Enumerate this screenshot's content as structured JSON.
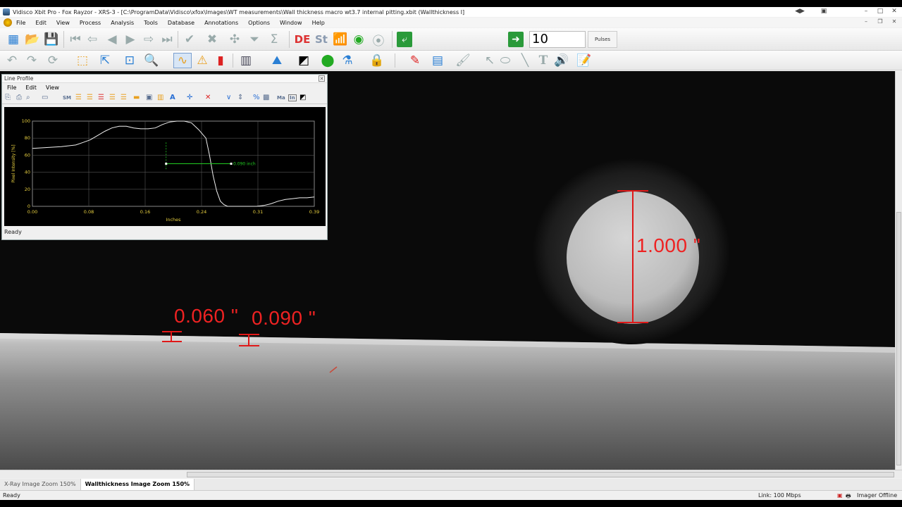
{
  "window": {
    "title": "Vidisco Xbit Pro - Fox Rayzor - XRS-3 - [C:\\ProgramData\\Vidisco\\xfox\\Images\\WT measurements\\Wall thickness macro wt3.7 internal pitting.xbit (Wallthickness I]"
  },
  "menu": [
    "File",
    "Edit",
    "View",
    "Process",
    "Analysis",
    "Tools",
    "Database",
    "Annotations",
    "Options",
    "Window",
    "Help"
  ],
  "toolbar": {
    "de_label": "DE",
    "st_label": "St",
    "pulses_value": "10",
    "pulses_label": "Pulses"
  },
  "line_profile": {
    "title": "Line Profile",
    "menu": [
      "File",
      "Edit",
      "View"
    ],
    "tool_text": [
      "SM",
      "Ma",
      "In"
    ],
    "status": "Ready",
    "chart_data": {
      "type": "line",
      "xlabel": "Inches",
      "ylabel": "Pixel Intensity [%]",
      "x_ticks": [
        "0.00",
        "0.08",
        "0.16",
        "0.24",
        "0.31",
        "0.39"
      ],
      "y_ticks": [
        "0",
        "20",
        "40",
        "60",
        "80",
        "100"
      ],
      "xlim": [
        0,
        0.39
      ],
      "ylim": [
        0,
        100
      ],
      "grid": true,
      "series": [
        {
          "x": [
            0.0,
            0.02,
            0.04,
            0.06,
            0.07,
            0.08,
            0.09,
            0.1,
            0.11,
            0.12,
            0.13,
            0.14,
            0.15,
            0.16,
            0.17,
            0.18,
            0.19,
            0.2,
            0.21,
            0.22,
            0.23,
            0.24,
            0.245,
            0.25,
            0.255,
            0.26,
            0.265,
            0.27,
            0.28,
            0.29,
            0.3,
            0.31,
            0.32,
            0.33,
            0.34,
            0.35,
            0.36,
            0.37,
            0.38,
            0.39
          ],
          "y": [
            68,
            69,
            70,
            72,
            75,
            78,
            83,
            88,
            92,
            94,
            94,
            92,
            91,
            91,
            92,
            96,
            99,
            100,
            100,
            98,
            90,
            80,
            60,
            36,
            18,
            6,
            2,
            0,
            0,
            0,
            0,
            0,
            1,
            3,
            6,
            8,
            9,
            10,
            10,
            11
          ]
        }
      ],
      "annotation": "0.090 inch"
    }
  },
  "measurements": {
    "m1": "0.060 \"",
    "m2": "0.090 \"",
    "m3": "1.000 \""
  },
  "tabs": [
    "X-Ray Image Zoom 150%",
    "Wallthickness Image Zoom 150%"
  ],
  "status": {
    "left": "Ready",
    "link": "Link: 100 Mbps",
    "imager": "Imager Offline"
  }
}
